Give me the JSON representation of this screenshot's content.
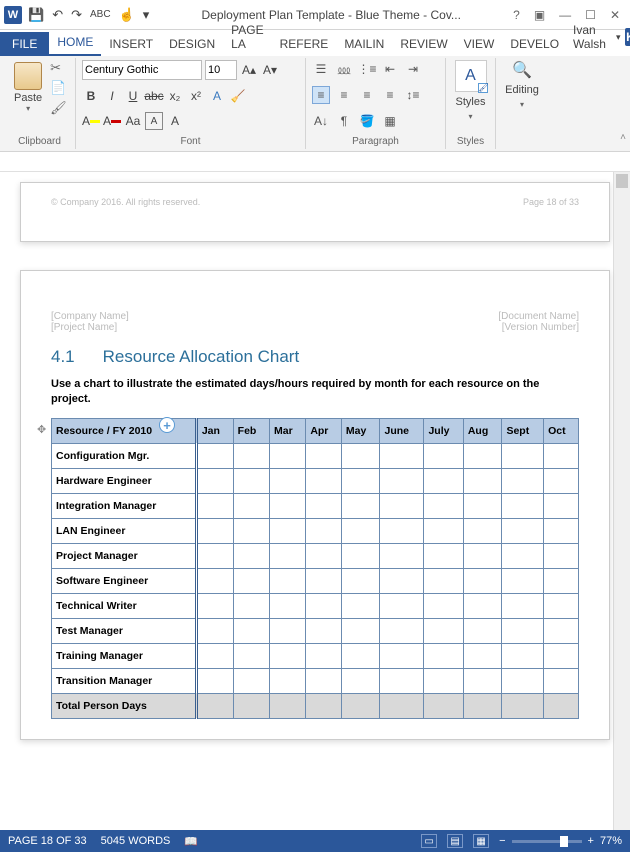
{
  "titlebar": {
    "title": "Deployment Plan Template - Blue Theme - Cov..."
  },
  "tabs": {
    "file": "FILE",
    "items": [
      "HOME",
      "INSERT",
      "DESIGN",
      "PAGE LA",
      "REFERE",
      "MAILIN",
      "REVIEW",
      "VIEW",
      "DEVELO"
    ],
    "active": 0,
    "user": "Ivan Walsh",
    "user_initial": "K"
  },
  "ribbon": {
    "clipboard": {
      "label": "Clipboard",
      "paste": "Paste"
    },
    "font": {
      "label": "Font",
      "name": "Century Gothic",
      "size": "10"
    },
    "paragraph": {
      "label": "Paragraph"
    },
    "styles": {
      "label": "Styles",
      "btn": "Styles"
    },
    "editing": {
      "label": "",
      "btn": "Editing"
    }
  },
  "doc": {
    "footer_left": "© Company 2016. All rights reserved.",
    "footer_right": "Page 18 of 33",
    "header": {
      "company": "[Company Name]",
      "project": "[Project Name]",
      "docname": "[Document Name]",
      "version": "[Version Number]"
    },
    "heading_num": "4.1",
    "heading_text": "Resource Allocation Chart",
    "para": "Use a chart to illustrate the estimated days/hours required by month for each resource on the project.",
    "table": {
      "head": [
        "Resource / FY 2010",
        "Jan",
        "Feb",
        "Mar",
        "Apr",
        "May",
        "June",
        "July",
        "Aug",
        "Sept",
        "Oct"
      ],
      "rows": [
        "Configuration Mgr.",
        "Hardware Engineer",
        "Integration Manager",
        "LAN Engineer",
        "Project Manager",
        "Software Engineer",
        "Technical Writer",
        "Test Manager",
        "Training Manager",
        "Transition Manager"
      ],
      "total": "Total Person Days"
    }
  },
  "status": {
    "page": "PAGE 18 OF 33",
    "words": "5045 WORDS",
    "zoom": "77%"
  }
}
